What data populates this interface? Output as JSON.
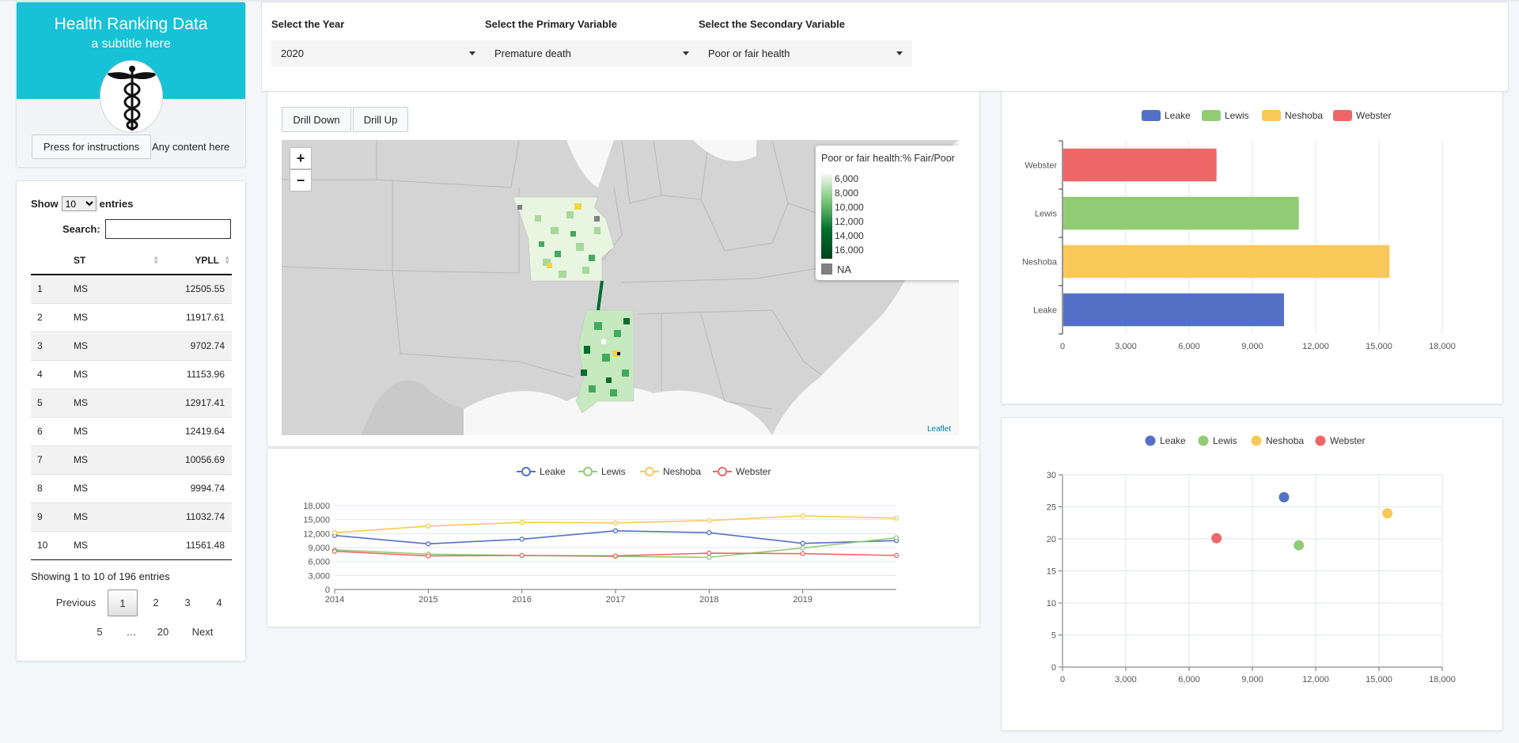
{
  "header": {
    "title": "Health Ranking Data",
    "subtitle": "a subtitle here",
    "instructions_button": "Press for instructions",
    "any_content": "Any content here"
  },
  "table": {
    "show_label": "Show",
    "entries_label": "entries",
    "page_length": "10",
    "search_label": "Search:",
    "search_value": "",
    "columns": [
      "",
      "ST",
      "YPLL"
    ],
    "rows": [
      [
        "1",
        "MS",
        "12505.55"
      ],
      [
        "2",
        "MS",
        "11917.61"
      ],
      [
        "3",
        "MS",
        "9702.74"
      ],
      [
        "4",
        "MS",
        "11153.96"
      ],
      [
        "5",
        "MS",
        "12917.41"
      ],
      [
        "6",
        "MS",
        "12419.64"
      ],
      [
        "7",
        "MS",
        "10056.69"
      ],
      [
        "8",
        "MS",
        "9994.74"
      ],
      [
        "9",
        "MS",
        "11032.74"
      ],
      [
        "10",
        "MS",
        "11561.48"
      ]
    ],
    "info": "Showing 1 to 10 of 196 entries",
    "pagination": {
      "previous": "Previous",
      "next": "Next",
      "pages": [
        "1",
        "2",
        "3",
        "4",
        "5",
        "…",
        "20"
      ],
      "current": "1"
    }
  },
  "selectors": {
    "year": {
      "label": "Select the Year",
      "value": "2020"
    },
    "primary": {
      "label": "Select the Primary Variable",
      "value": "Premature death"
    },
    "secondary": {
      "label": "Select the Secondary Variable",
      "value": "Poor or fair health"
    }
  },
  "map": {
    "drill_down": "Drill Down",
    "drill_up": "Drill Up",
    "zoom_in": "+",
    "zoom_out": "−",
    "legend_title": "Poor or fair health:% Fair/Poor",
    "legend_ticks": [
      "6,000",
      "8,000",
      "10,000",
      "12,000",
      "14,000",
      "16,000"
    ],
    "na_label": "NA",
    "attribution": "Leaflet",
    "colors": {
      "land": "#d4d4d4",
      "low": "#f7fcf5",
      "high": "#00441b",
      "highlight": "#f2d43c"
    }
  },
  "series_colors": {
    "Leake": "#5470c6",
    "Lewis": "#91cc75",
    "Neshoba": "#fac858",
    "Webster": "#ee6666"
  },
  "chart_data": [
    {
      "type": "line",
      "x": [
        2014,
        2015,
        2016,
        2017,
        2018,
        2019,
        2020
      ],
      "xticks": [
        "2014",
        "2015",
        "2016",
        "2017",
        "2018",
        "2019"
      ],
      "yticks": [
        "0",
        "3,000",
        "6,000",
        "9,000",
        "12,000",
        "15,000",
        "18,000"
      ],
      "ylim": [
        0,
        18000
      ],
      "legend": "top-center",
      "series": [
        {
          "name": "Leake",
          "values": [
            11600,
            9800,
            10800,
            12600,
            12200,
            9900,
            10500
          ]
        },
        {
          "name": "Lewis",
          "values": [
            8500,
            7600,
            7300,
            7100,
            6900,
            8900,
            11100
          ]
        },
        {
          "name": "Neshoba",
          "values": [
            12200,
            13600,
            14400,
            14300,
            14800,
            15800,
            15300
          ]
        },
        {
          "name": "Webster",
          "values": [
            8200,
            7200,
            7300,
            7200,
            7800,
            7700,
            7300
          ]
        }
      ]
    },
    {
      "type": "bar",
      "orientation": "horizontal",
      "categories": [
        "Leake",
        "Neshoba",
        "Lewis",
        "Webster"
      ],
      "values": [
        10500,
        15500,
        11200,
        7300
      ],
      "xticks": [
        "0",
        "3,000",
        "6,000",
        "9,000",
        "12,000",
        "15,000",
        "18,000"
      ],
      "xlim": [
        0,
        18000
      ],
      "legend": "top-center",
      "legend_items": [
        "Leake",
        "Lewis",
        "Neshoba",
        "Webster"
      ]
    },
    {
      "type": "scatter",
      "xticks": [
        "0",
        "3,000",
        "6,000",
        "9,000",
        "12,000",
        "15,000",
        "18,000"
      ],
      "yticks": [
        "0",
        "5",
        "10",
        "15",
        "20",
        "25",
        "30"
      ],
      "xlim": [
        0,
        18000
      ],
      "ylim": [
        0,
        30
      ],
      "legend": "top-center",
      "grid": true,
      "series": [
        {
          "name": "Leake",
          "x": 10500,
          "y": 26.5
        },
        {
          "name": "Lewis",
          "x": 11200,
          "y": 19
        },
        {
          "name": "Neshoba",
          "x": 15400,
          "y": 24
        },
        {
          "name": "Webster",
          "x": 7300,
          "y": 20.1
        }
      ]
    }
  ]
}
